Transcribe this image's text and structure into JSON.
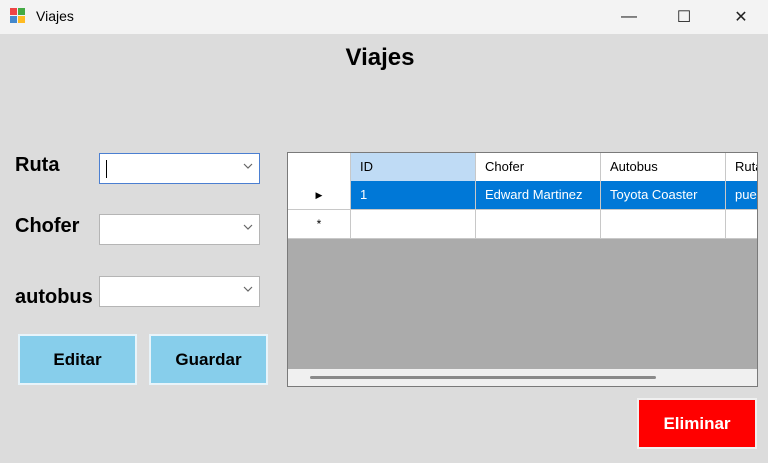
{
  "window": {
    "title": "Viajes",
    "minimize": "—",
    "maximize": "☐",
    "close": "✕"
  },
  "form": {
    "title": "Viajes",
    "labels": {
      "ruta": "Ruta",
      "chofer": "Chofer",
      "autobus": "autobus"
    },
    "buttons": {
      "editar": "Editar",
      "guardar": "Guardar",
      "eliminar": "Eliminar"
    }
  },
  "grid": {
    "columns": [
      "ID",
      "Chofer",
      "Autobus",
      "Ruta"
    ],
    "rows": [
      {
        "marker": "▶",
        "cells": [
          "1",
          "Edward Martinez",
          "Toyota Coaster",
          "puer"
        ]
      },
      {
        "marker": "*",
        "cells": [
          "",
          "",
          "",
          ""
        ]
      }
    ]
  },
  "colors": {
    "button": "#87ceeb",
    "delete": "#ff0000",
    "selection": "#0078d7"
  }
}
